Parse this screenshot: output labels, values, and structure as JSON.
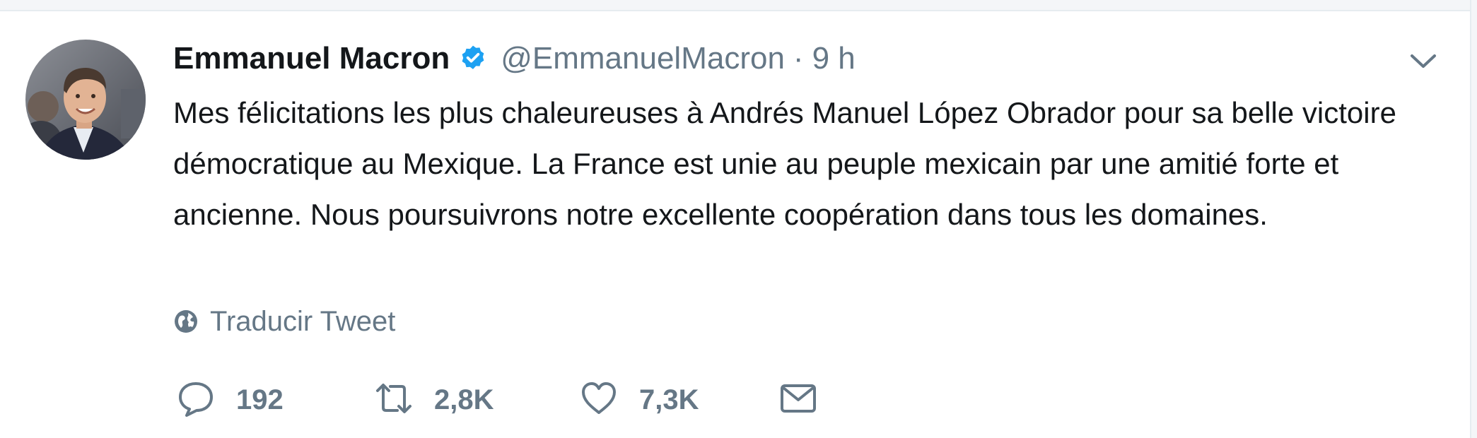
{
  "tweet": {
    "author": {
      "display_name": "Emmanuel Macron",
      "handle": "@EmmanuelMacron",
      "verified": true
    },
    "separator": "·",
    "timestamp": "9 h",
    "text": "Mes félicitations les plus chaleureuses à Andrés Manuel López Obrador pour sa belle victoire démocratique au Mexique. La France est unie au peuple mexicain par une amitié forte et ancienne. Nous poursuivrons notre excellente coopération dans tous les domaines.",
    "translate_label": "Traducir Tweet",
    "actions": {
      "reply_count": "192",
      "retweet_count": "2,8K",
      "like_count": "7,3K"
    }
  },
  "icons": {
    "verified": "verified-badge-icon",
    "caret": "chevron-down-icon",
    "globe": "globe-icon",
    "reply": "reply-icon",
    "retweet": "retweet-icon",
    "like": "heart-icon",
    "message": "envelope-icon"
  },
  "colors": {
    "text": "#14171a",
    "secondary": "#657786",
    "verified_blue": "#1da1f2",
    "background": "#ffffff"
  }
}
